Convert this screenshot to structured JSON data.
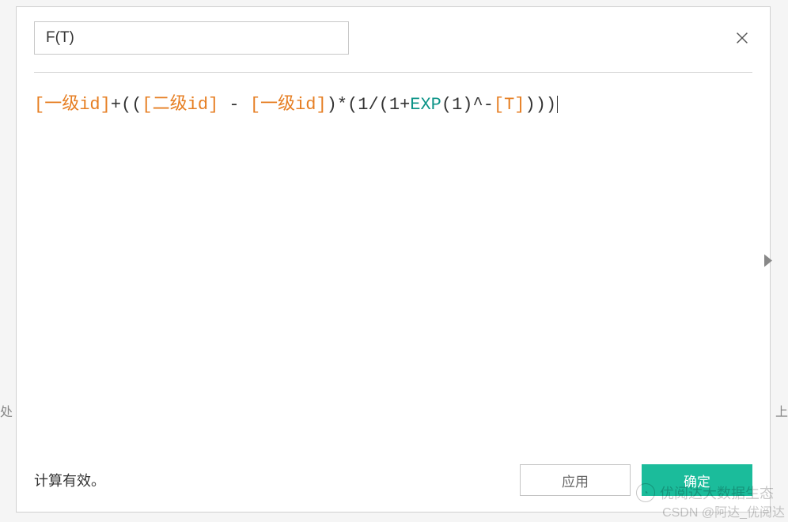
{
  "dialog": {
    "field_name": "F(T)",
    "status_text": "计算有效。",
    "apply_label": "应用",
    "ok_label": "确定"
  },
  "formula": {
    "tokens": [
      {
        "text": "[一级id]",
        "cls": "tok-field"
      },
      {
        "text": "+((",
        "cls": "tok-op"
      },
      {
        "text": "[二级id]",
        "cls": "tok-field"
      },
      {
        "text": " - ",
        "cls": "tok-op"
      },
      {
        "text": "[一级id]",
        "cls": "tok-field"
      },
      {
        "text": ")*(1/(1+",
        "cls": "tok-op"
      },
      {
        "text": "EXP",
        "cls": "tok-func"
      },
      {
        "text": "(1)^-",
        "cls": "tok-op"
      },
      {
        "text": "[T]",
        "cls": "tok-field"
      },
      {
        "text": ")))",
        "cls": "tok-op"
      }
    ]
  },
  "watermarks": {
    "line1": "优阅达大数据生态",
    "line2": "CSDN @阿达_优阅达"
  },
  "bg_hints": {
    "left": "处",
    "right": "上"
  }
}
